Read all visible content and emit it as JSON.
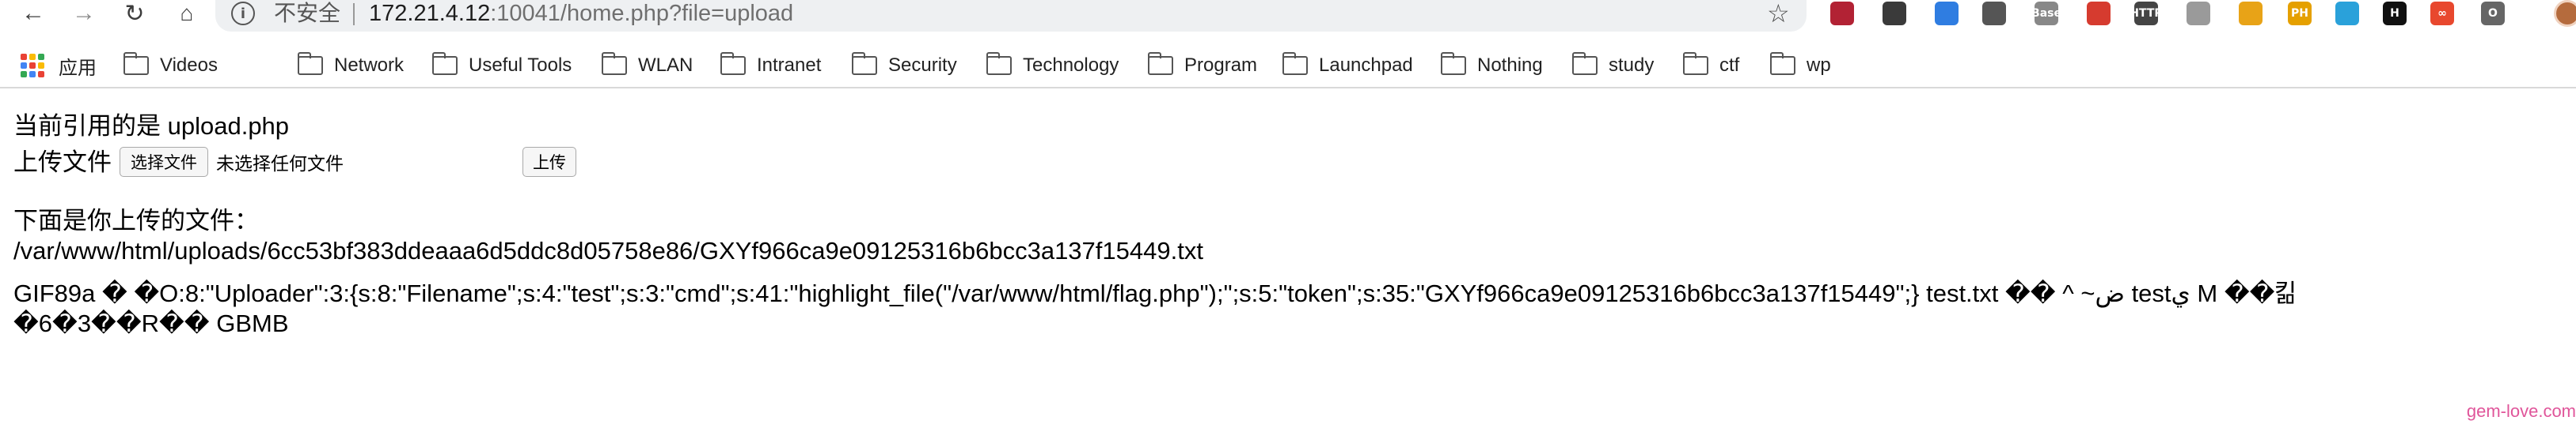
{
  "browser": {
    "security_label": "不安全",
    "url_host": "172.21.4.12",
    "url_rest": ":10041/home.php?file=upload"
  },
  "extensions": [
    {
      "name": "us-flag-icon",
      "color": "#b22234",
      "label": ""
    },
    {
      "name": "laptop-icon",
      "color": "#3a3a3a",
      "label": ""
    },
    {
      "name": "cloud-icon",
      "color": "#2f7de1",
      "label": ""
    },
    {
      "name": "cookie-icon",
      "color": "#555555",
      "label": ""
    },
    {
      "name": "base64-icon",
      "color": "#888888",
      "label": "Base"
    },
    {
      "name": "santa-icon",
      "color": "#d63b2f",
      "label": ""
    },
    {
      "name": "http-icon",
      "color": "#444444",
      "label": "HTTP"
    },
    {
      "name": "gear-ext-icon",
      "color": "#9a9a9a",
      "label": ""
    },
    {
      "name": "shield-ext-icon",
      "color": "#e8a317",
      "label": ""
    },
    {
      "name": "ph-icon",
      "color": "#e5a000",
      "label": "PH"
    },
    {
      "name": "telegram-icon",
      "color": "#2aa1da",
      "label": ""
    },
    {
      "name": "h-icon",
      "color": "#111111",
      "label": "H"
    },
    {
      "name": "infinity-icon",
      "color": "#e8482e",
      "label": "∞"
    },
    {
      "name": "o-icon",
      "color": "#666666",
      "label": "O"
    }
  ],
  "bookmarks": [
    "应用",
    "Videos",
    "Network",
    "Useful Tools",
    "WLAN",
    "Intranet",
    "Security",
    "Technology",
    "Program",
    "Launchpad",
    "Nothing",
    "study",
    "ctf",
    "wp"
  ],
  "page": {
    "current_include": "当前引用的是 upload.php",
    "upload_label": "上传文件",
    "choose_file_button": "选择文件",
    "no_file_chosen": "未选择任何文件",
    "submit_button": "上传",
    "uploaded_heading": "下面是你上传的文件：",
    "uploaded_path": "/var/www/html/uploads/6cc53bf383ddeaaa6d5ddc8d05758e86/GXYf966ca9e09125316b6bcc3a137f15449.txt",
    "file_content_line1": "GIF89a �    �O:8:\"Uploader\":3:{s:8:\"Filename\";s:4:\"test\";s:3:\"cmd\";s:41:\"highlight_file(\"/var/www/html/flag.php\");\";s:5:\"token\";s:35:\"GXYf966ca9e09125316b6bcc3a137f15449\";} test.txt �� ^  ~ض  testي M ��킮",
    "file_content_line2": "�6�3��R�� GBMB"
  },
  "watermark": "gem-love.com"
}
